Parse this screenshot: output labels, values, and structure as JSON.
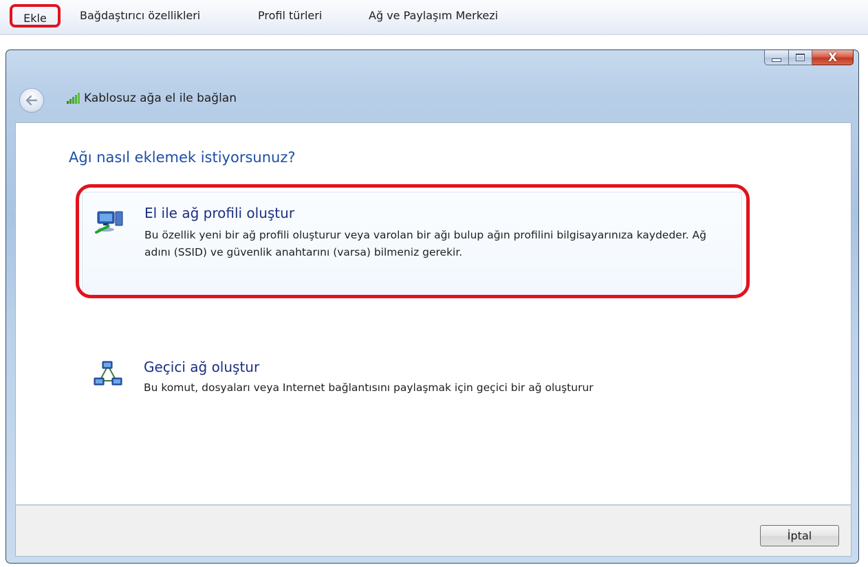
{
  "toolbar": {
    "items": [
      "Ekle",
      "Bağdaştırıcı özellikleri",
      "Profil türleri",
      "Ağ ve Paylaşım Merkezi"
    ]
  },
  "window": {
    "title": "Kablosuz ağa el ile bağlan",
    "close_glyph": "X"
  },
  "content": {
    "heading": "Ağı nasıl eklemek istiyorsunuz?",
    "options": [
      {
        "title": "El ile ağ profili oluştur",
        "description": "Bu özellik yeni bir ağ profili oluşturur veya varolan bir ağı bulup ağın profilini bilgisayarınıza kaydeder. Ağ adını (SSID) ve güvenlik anahtarını (varsa) bilmeniz gerekir.",
        "icon": "network-computer-icon",
        "highlighted": true
      },
      {
        "title": "Geçici ağ oluştur",
        "description": "Bu komut, dosyaları veya Internet bağlantısını paylaşmak için geçici bir ağ oluşturur",
        "icon": "adhoc-network-icon",
        "highlighted": false
      }
    ]
  },
  "footer": {
    "cancel_label": "İptal"
  },
  "colors": {
    "highlight": "#e0141e",
    "heading": "#1c4ea6",
    "option_title": "#1c2f80"
  }
}
